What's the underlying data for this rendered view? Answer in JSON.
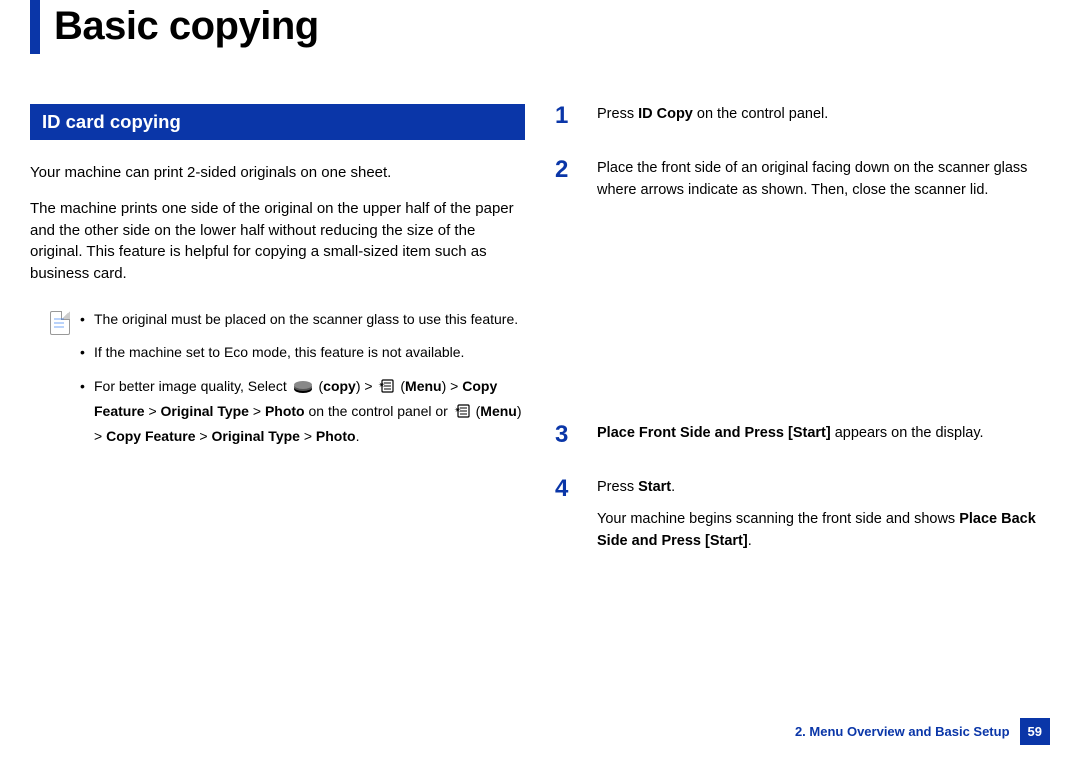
{
  "title": "Basic copying",
  "section_heading": "ID card copying",
  "intro_para1": "Your machine can print 2-sided originals on one sheet.",
  "intro_para2": "The machine prints one side of the original on the upper half of the paper and the other side on the lower half without reducing the size of the original. This feature is helpful for copying a small-sized item such as business card.",
  "notes": {
    "n1": "The original must be placed on the scanner glass to use this feature.",
    "n2": "If the machine set to Eco mode, this feature is not available.",
    "n3_pre": "For better image quality, Select ",
    "n3_copy": "copy",
    "n3_gt1": ") > ",
    "n3_menu": "Menu",
    "n3_gt2": ") > ",
    "n3_copyfeature": "Copy Feature",
    "n3_gt3": " > ",
    "n3_origtype": "Original Type",
    "n3_gt4": " > ",
    "n3_photo": "Photo",
    "n3_oncp": " on the control panel or ",
    "n3_menu2": "Menu",
    "n3_gt5": ") > ",
    "n3_copyfeature2": "Copy Feature",
    "n3_gt6": " > ",
    "n3_origtype2": "Original Type",
    "n3_gt7": " > ",
    "n3_photo2": "Photo",
    "n3_end": "."
  },
  "steps": {
    "s1": {
      "num": "1",
      "t1": "Press ",
      "bold1": "ID Copy",
      "t2": " on the control panel."
    },
    "s2": {
      "num": "2",
      "t1": "Place the front side of an original facing down on the scanner glass where arrows indicate as shown. Then, close the scanner lid."
    },
    "s3": {
      "num": "3",
      "bold1": "Place Front Side and Press [Start]",
      "t2": " appears on the display."
    },
    "s4": {
      "num": "4",
      "p1_t1": "Press ",
      "p1_bold": "Start",
      "p1_t2": ".",
      "p2_t1": "Your machine begins scanning the front side and shows ",
      "p2_bold": "Place Back Side and Press [Start]",
      "p2_t2": "."
    }
  },
  "footer": {
    "chapter": "2. Menu Overview and Basic Setup",
    "page": "59"
  }
}
